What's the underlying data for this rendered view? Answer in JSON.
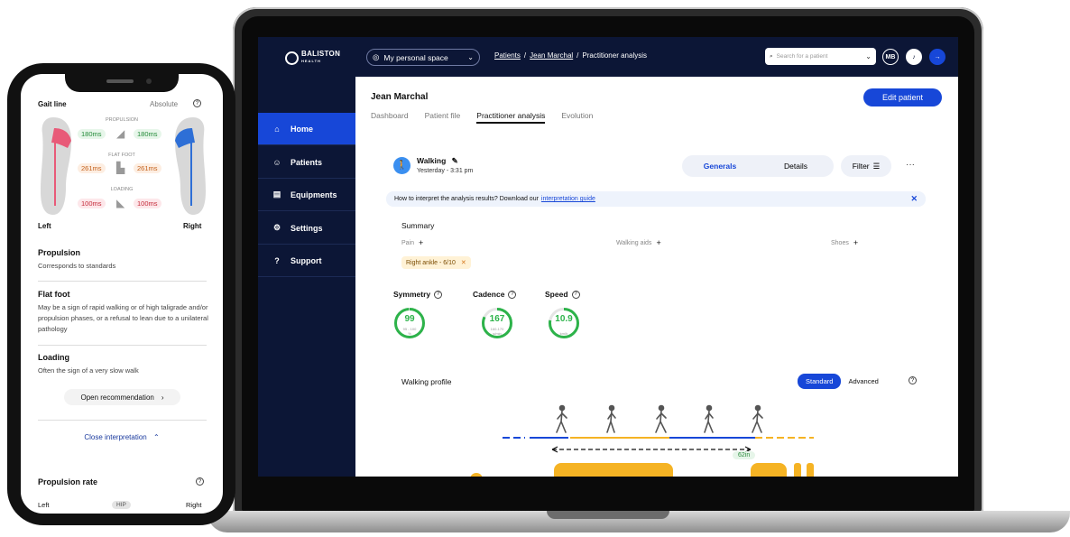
{
  "desktop": {
    "brand": {
      "name": "BALISTON",
      "sub": "HEALTH"
    },
    "space_select": "My personal space",
    "breadcrumb": {
      "patients": "Patients",
      "sep1": "/",
      "patient": "Jean Marchal",
      "sep2": "/",
      "current": "Practitioner analysis"
    },
    "search": {
      "placeholder": "Search for a patient"
    },
    "avatar": "MB",
    "sidebar": [
      {
        "label": "Home",
        "icon": "home-icon",
        "glyph": "⌂",
        "active": true
      },
      {
        "label": "Patients",
        "icon": "patients-icon",
        "glyph": "☺"
      },
      {
        "label": "Equipments",
        "icon": "equipment-icon",
        "glyph": "▤"
      },
      {
        "label": "Settings",
        "icon": "gear-icon",
        "glyph": "⚙"
      },
      {
        "label": "Support",
        "icon": "help-icon",
        "glyph": "?"
      }
    ],
    "patient_name": "Jean Marchal",
    "edit_button": "Edit patient",
    "tabs": [
      "Dashboard",
      "Patient file",
      "Practitioner analysis",
      "Evolution"
    ],
    "active_tab": "Practitioner analysis",
    "session": {
      "title": "Walking",
      "time": "Yesterday - 3:31 pm"
    },
    "view_toggle": {
      "generals": "Generals",
      "details": "Details",
      "active": "Generals"
    },
    "filter": "Filter",
    "more": "···",
    "info_bar": {
      "text": "How to interpret the analysis results? Download our",
      "link": "interpretation guide"
    },
    "summary": {
      "title": "Summary",
      "pain_label": "Pain",
      "aids_label": "Walking aids",
      "shoes_label": "Shoes",
      "pain_tag": "Right ankle - 6/10"
    },
    "metrics": [
      {
        "title": "Symmetry",
        "value": "99",
        "range": "95 - 100",
        "unit": "%",
        "fill": 0.99
      },
      {
        "title": "Cadence",
        "value": "167",
        "range": "160-170",
        "unit": "s/min",
        "fill": 0.82
      },
      {
        "title": "Speed",
        "value": "10.9",
        "range": "",
        "unit": "km/h",
        "fill": 0.78
      }
    ],
    "walking_profile": {
      "title": "Walking profile",
      "standard": "Standard",
      "advanced": "Advanced",
      "distance": "62in"
    },
    "colors": {
      "navy": "#0c1636",
      "accent": "#1747d8",
      "green": "#2db34a",
      "orange": "#f5b324"
    }
  },
  "phone": {
    "gait_title": "Gait line",
    "gait_mode": "Absolute",
    "phases": [
      {
        "label": "PROPULSION",
        "left": "180ms",
        "right": "180ms",
        "status": "green"
      },
      {
        "label": "FLAT FOOT",
        "left": "261ms",
        "right": "261ms",
        "status": "orange"
      },
      {
        "label": "LOADING",
        "left": "100ms",
        "right": "100ms",
        "status": "red"
      }
    ],
    "left_label": "Left",
    "right_label": "Right",
    "sections": [
      {
        "title": "Propulsion",
        "text": "Corresponds to standards"
      },
      {
        "title": "Flat foot",
        "text": "May be a sign of rapid walking or of high taligrade and/or propulsion phases, or a refusal to lean due to a unilateral pathology"
      },
      {
        "title": "Loading",
        "text": "Often the sign of a very slow walk"
      }
    ],
    "open_recommendation": "Open recommendation",
    "close_interpretation": "Close interpretation",
    "propulsion_rate": {
      "title": "Propulsion rate",
      "left": "Left",
      "center": "HIP",
      "right": "Right"
    }
  }
}
